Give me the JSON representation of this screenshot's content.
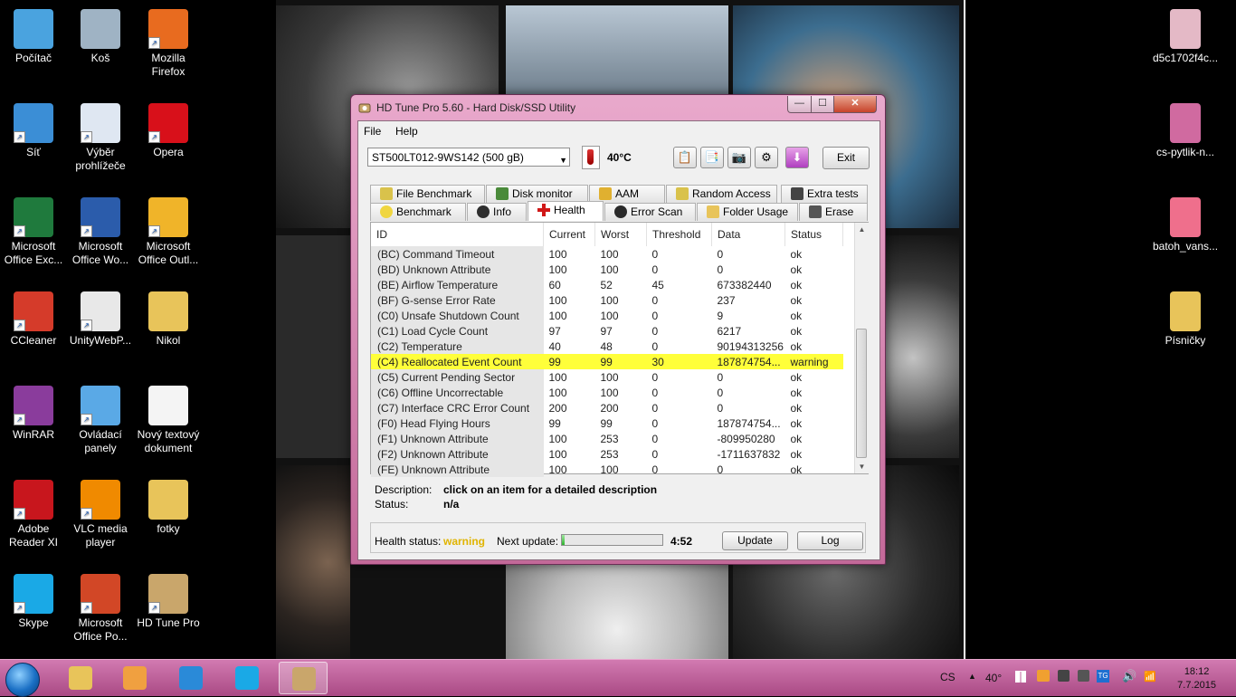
{
  "desktop": {
    "left_icons": [
      {
        "label": "Počítač",
        "icon": "computer-icon",
        "color": "#4aa3df"
      },
      {
        "label": "Koš",
        "icon": "recycle-bin-icon",
        "color": "#9fb3c4"
      },
      {
        "label": "Mozilla Firefox",
        "icon": "firefox-icon",
        "color": "#e86b1f"
      },
      {
        "label": "Síť",
        "icon": "network-icon",
        "color": "#3b8ed6"
      },
      {
        "label": "Výběr prohlížeče",
        "icon": "checklist-icon",
        "color": "#dfe7f2"
      },
      {
        "label": "Opera",
        "icon": "opera-icon",
        "color": "#d8101a"
      },
      {
        "label": "Microsoft Office Exc...",
        "icon": "excel-icon",
        "color": "#1f7a3d"
      },
      {
        "label": "Microsoft Office Wo...",
        "icon": "word-icon",
        "color": "#2b5cab"
      },
      {
        "label": "Microsoft Office Outl...",
        "icon": "outlook-icon",
        "color": "#f0b429"
      },
      {
        "label": "CCleaner",
        "icon": "ccleaner-icon",
        "color": "#d53b2a"
      },
      {
        "label": "UnityWebP...",
        "icon": "unity-icon",
        "color": "#e8e8e8"
      },
      {
        "label": "Nikol",
        "icon": "folder-icon",
        "color": "#e8c45a"
      },
      {
        "label": "WinRAR",
        "icon": "winrar-icon",
        "color": "#8a3c9c"
      },
      {
        "label": "Ovládací panely",
        "icon": "control-panel-icon",
        "color": "#5aa9e6"
      },
      {
        "label": "Nový textový dokument",
        "icon": "text-document-icon",
        "color": "#f4f4f4"
      },
      {
        "label": "Adobe Reader XI",
        "icon": "adobe-reader-icon",
        "color": "#c8161d"
      },
      {
        "label": "VLC media player",
        "icon": "vlc-icon",
        "color": "#f08a00"
      },
      {
        "label": "fotky",
        "icon": "folder-icon",
        "color": "#e8c45a"
      },
      {
        "label": "Skype",
        "icon": "skype-icon",
        "color": "#1aa9e6"
      },
      {
        "label": "Microsoft Office Po...",
        "icon": "powerpoint-icon",
        "color": "#d24726"
      },
      {
        "label": "HD Tune Pro",
        "icon": "hdtune-icon",
        "color": "#c9a66b"
      }
    ],
    "right_icons": [
      {
        "label": "d5c1702f4c...",
        "icon": "image-file-icon",
        "color": "#e4b9c6"
      },
      {
        "label": "cs-pytlik-n...",
        "icon": "image-file-icon",
        "color": "#d06aa0"
      },
      {
        "label": "batoh_vans...",
        "icon": "image-file-icon",
        "color": "#ef6f8c"
      },
      {
        "label": "Písničky",
        "icon": "folder-icon",
        "color": "#e8c45a"
      }
    ]
  },
  "window": {
    "title": "HD Tune Pro 5.60 - Hard Disk/SSD Utility",
    "controls": {
      "minimize": "—",
      "maximize": "☐",
      "close": "✕"
    },
    "menu": [
      {
        "label": "File"
      },
      {
        "label": "Help"
      }
    ],
    "drive": "ST500LT012-9WS142 (500 gB)",
    "temperature": "40°C",
    "exit_label": "Exit",
    "tabs_row1": [
      "File Benchmark",
      "Disk monitor",
      "AAM",
      "Random Access",
      "Extra tests"
    ],
    "tabs_row2": [
      "Benchmark",
      "Info",
      "Health",
      "Error Scan",
      "Folder Usage",
      "Erase"
    ],
    "active_tab": "Health",
    "columns": [
      "ID",
      "Current",
      "Worst",
      "Threshold",
      "Data",
      "Status"
    ],
    "rows": [
      [
        "(BC) Command Timeout",
        "100",
        "100",
        "0",
        "0",
        "ok"
      ],
      [
        "(BD) Unknown Attribute",
        "100",
        "100",
        "0",
        "0",
        "ok"
      ],
      [
        "(BE) Airflow Temperature",
        "60",
        "52",
        "45",
        "673382440",
        "ok"
      ],
      [
        "(BF) G-sense Error Rate",
        "100",
        "100",
        "0",
        "237",
        "ok"
      ],
      [
        "(C0) Unsafe Shutdown Count",
        "100",
        "100",
        "0",
        "9",
        "ok"
      ],
      [
        "(C1) Load Cycle Count",
        "97",
        "97",
        "0",
        "6217",
        "ok"
      ],
      [
        "(C2) Temperature",
        "40",
        "48",
        "0",
        "90194313256",
        "ok"
      ],
      [
        "(C4) Reallocated Event Count",
        "99",
        "99",
        "30",
        "187874754...",
        "warning"
      ],
      [
        "(C5) Current Pending Sector",
        "100",
        "100",
        "0",
        "0",
        "ok"
      ],
      [
        "(C6) Offline Uncorrectable",
        "100",
        "100",
        "0",
        "0",
        "ok"
      ],
      [
        "(C7) Interface CRC Error Count",
        "200",
        "200",
        "0",
        "0",
        "ok"
      ],
      [
        "(F0) Head Flying Hours",
        "99",
        "99",
        "0",
        "187874754...",
        "ok"
      ],
      [
        "(F1) Unknown Attribute",
        "100",
        "253",
        "0",
        "-809950280",
        "ok"
      ],
      [
        "(F2) Unknown Attribute",
        "100",
        "253",
        "0",
        "-1711637832",
        "ok"
      ],
      [
        "(FE) Unknown Attribute",
        "100",
        "100",
        "0",
        "0",
        "ok"
      ]
    ],
    "description_label": "Description:",
    "description_value": "click on an item for a detailed description",
    "status_label": "Status:",
    "status_value": "n/a",
    "health_status_label": "Health status:",
    "health_status_value": "warning",
    "next_update_label": "Next update:",
    "next_update_progress": 0.03,
    "next_update_time": "4:52",
    "update_label": "Update",
    "log_label": "Log",
    "warning_color": "#ffff3a"
  },
  "taskbar": {
    "start_icon": "windows-start-icon",
    "apps": [
      {
        "icon": "file-explorer-icon",
        "color": "#e8c45a"
      },
      {
        "icon": "media-player-icon",
        "color": "#f0a040"
      },
      {
        "icon": "internet-explorer-icon",
        "color": "#2a8ad8"
      },
      {
        "icon": "skype-icon",
        "color": "#1aa9e6"
      },
      {
        "icon": "hdtune-icon",
        "color": "#c9a66b"
      }
    ],
    "language": "CS",
    "tray_temp": "40°",
    "time": "18:12",
    "date": "7.7.2015"
  }
}
